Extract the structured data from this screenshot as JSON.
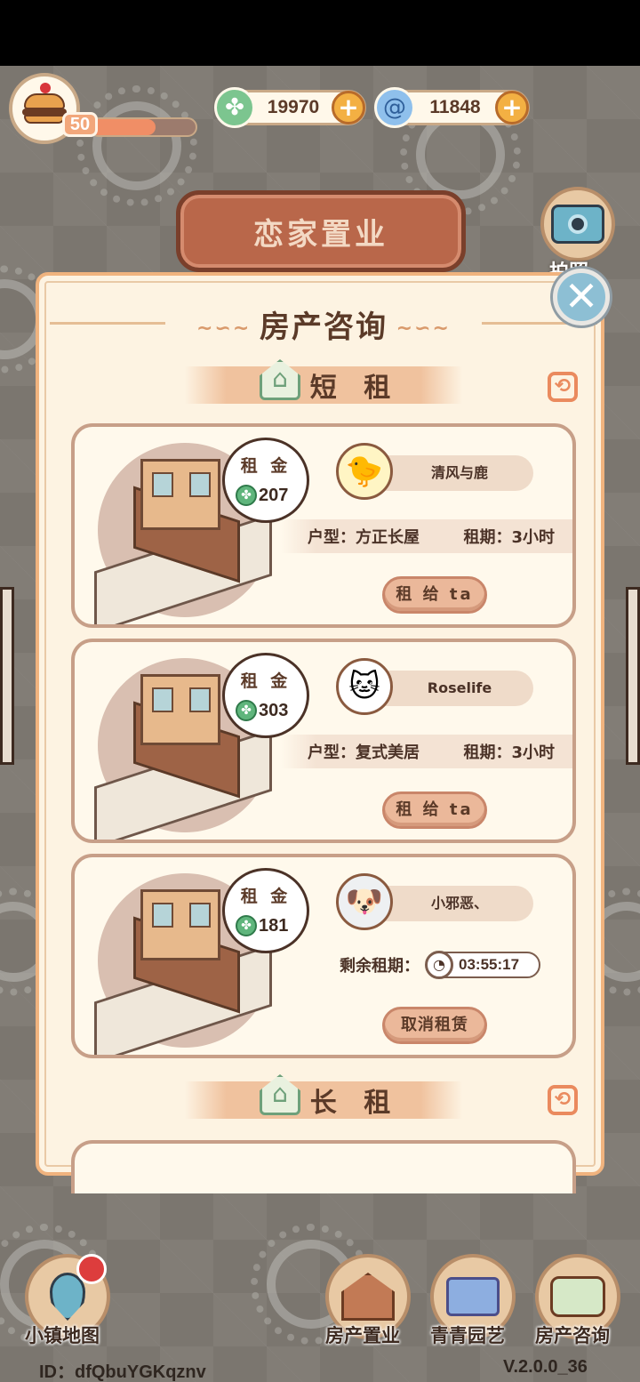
{
  "player": {
    "level": "50",
    "xp_fraction": 0.62
  },
  "currency": {
    "clover": {
      "value": "19970",
      "icon": "clover-icon",
      "color": "#5fb57c"
    },
    "swirl": {
      "value": "11848",
      "icon": "swirl-icon",
      "color": "#6fa6e0"
    }
  },
  "header": {
    "sign_title": "恋家置业",
    "camera_label": "拍照"
  },
  "panel": {
    "title": "房产咨询",
    "short_term_label": "短 租",
    "long_term_label": "长 租",
    "cards": [
      {
        "rent_label": "租 金",
        "rent_value": "207",
        "tenant": "清风与鹿",
        "tenant_avatar": "chick-avatar",
        "house_type": "户型：方正长屋",
        "lease": "租期：3小时",
        "button": "租 给 ta"
      },
      {
        "rent_label": "租 金",
        "rent_value": "303",
        "tenant": "Roselife",
        "tenant_avatar": "cat-rose-avatar",
        "house_type": "户型：复式美居",
        "lease": "租期：3小时",
        "button": "租 给 ta"
      },
      {
        "rent_label": "租 金",
        "rent_value": "181",
        "tenant": "小邪恶、",
        "tenant_avatar": "dog-avatar",
        "remaining_label": "剩余租期：",
        "remaining_time": "03:55:17",
        "button": "取消租赁"
      }
    ]
  },
  "nav": {
    "map": "小镇地图",
    "property": "房产置业",
    "garden": "青青园艺",
    "consult": "房产咨询"
  },
  "footer": {
    "id": "ID：dfQbuYGKqznv",
    "version": "V.2.0.0_36"
  },
  "colors": {
    "panel_bg": "#fdf3e2",
    "panel_border": "#f0b37e",
    "accent_orange": "#ea8a5e",
    "close_blue": "#8dbfd4"
  }
}
